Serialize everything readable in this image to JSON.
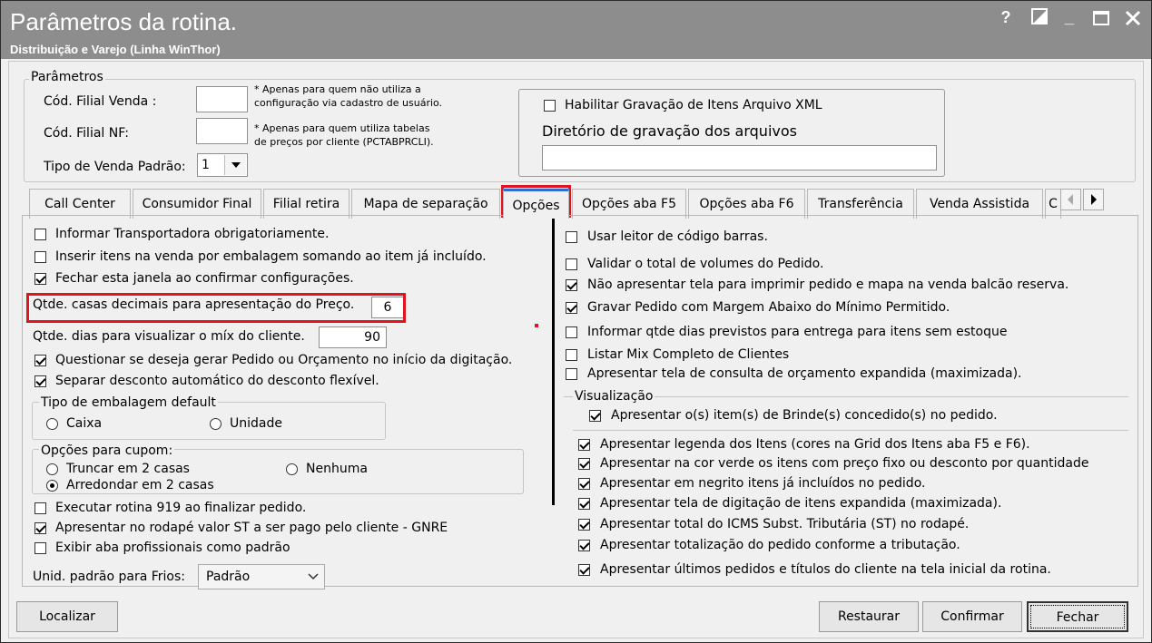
{
  "window": {
    "title": "Parâmetros da rotina.",
    "subtitle": "Distribuição e Varejo (Linha WinThor)",
    "help": "?",
    "min": "_"
  },
  "parametros": {
    "legend": "Parâmetros",
    "filial_venda_label": "Cód. Filial Venda :",
    "filial_venda_value": "",
    "filial_venda_note": "* Apenas para quem não utiliza a\nconfiguração via cadastro de usuário.",
    "filial_nf_label": "Cód. Filial NF:",
    "filial_nf_value": "",
    "filial_nf_note": "* Apenas para quem utiliza tabelas\nde preços por cliente (PCTABPRCLI).",
    "tipo_venda_label": "Tipo de Venda Padrão:",
    "tipo_venda_value": "1",
    "xml_checkbox": "Habilitar Gravação de Itens Arquivo XML",
    "xml_checked": false,
    "diretorio_label": "Diretório de gravação dos arquivos",
    "diretorio_value": ""
  },
  "tabs": [
    "Call Center",
    "Consumidor Final",
    "Filial retira",
    "Mapa de separação",
    "Opções",
    "Opções aba F5",
    "Opções aba F6",
    "Transferência",
    "Venda Assistida",
    "C"
  ],
  "active_tab": "Opções",
  "left": {
    "c1": "Informar Transportadora obrigatoriamente.",
    "c2": "Inserir itens na venda por embalagem somando ao item já incluído.",
    "c3": "Fechar esta janela ao confirmar configurações.",
    "casas_label": "Qtde. casas decimais para apresentação do Preço.",
    "casas_value": "6",
    "dias_label": "Qtde. dias para visualizar o míx do cliente.",
    "dias_value": "90",
    "c4": "Questionar se deseja gerar Pedido ou Orçamento no início da digitação.",
    "c5": "Separar desconto automático do desconto flexível.",
    "embalagem_legend": "Tipo de embalagem default",
    "emb_caixa": "Caixa",
    "emb_unidade": "Unidade",
    "cupom_legend": "Opções para cupom:",
    "cupom_truncar": "Truncar em 2 casas",
    "cupom_nenhuma": "Nenhuma",
    "cupom_arredondar": "Arredondar em 2 casas",
    "c6": "Executar rotina 919 ao finalizar pedido.",
    "c7": "Apresentar no rodapé valor ST a ser pago pelo cliente - GNRE",
    "c8": "Exibir aba profissionais como padrão",
    "frios_label": "Unid. padrão para Frios:",
    "frios_value": "Padrão"
  },
  "right": {
    "r1": "Usar leitor de código barras.",
    "r2": "Validar o total de volumes do Pedido.",
    "r3": "Não apresentar tela para imprimir pedido e mapa na venda balcão reserva.",
    "r4": "Gravar Pedido com Margem Abaixo do Mínimo Permitido.",
    "r5": "Informar qtde dias previstos para entrega para itens sem estoque",
    "r6": "Listar Mix Completo de Clientes",
    "r7": "Apresentar tela de consulta de orçamento expandida (maximizada).",
    "vis_legend": "Visualização",
    "v1": "Apresentar o(s) item(s) de Brinde(s) concedido(s) no pedido.",
    "v2": "Apresentar legenda dos Itens (cores na Grid dos Itens aba F5 e F6).",
    "v3": "Apresentar na cor verde os itens com preço fixo ou desconto por quantidade",
    "v4": "Apresentar em negrito itens já incluídos no pedido.",
    "v5": "Apresentar tela de digitação de itens expandida (maximizada).",
    "v6": "Apresentar total do ICMS Subst. Tributária (ST) no rodapé.",
    "v7": "Apresentar totalização do pedido conforme a tributação.",
    "v8": "Apresentar últimos pedidos e títulos do cliente na tela inicial da rotina."
  },
  "buttons": {
    "localizar": "Localizar",
    "restaurar": "Restaurar",
    "confirmar": "Confirmar",
    "fechar": "Fechar"
  },
  "colors": {
    "titlebar": "#8d8d8d",
    "highlight": "#e0141e"
  }
}
